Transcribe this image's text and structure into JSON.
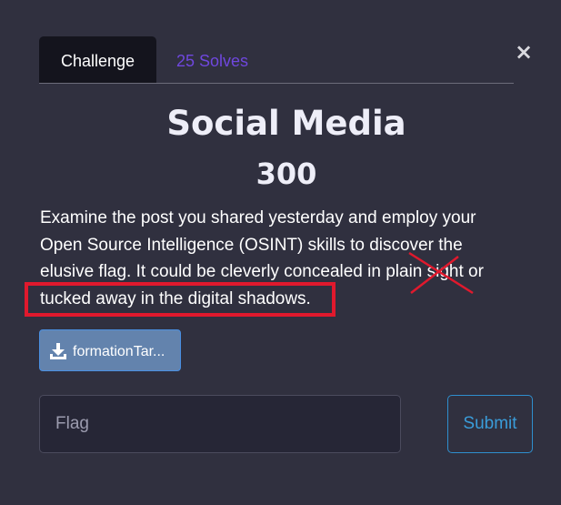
{
  "modal": {
    "close_label": "×"
  },
  "tabs": [
    {
      "label": "Challenge",
      "active": true
    },
    {
      "label": "25 Solves",
      "active": false
    }
  ],
  "challenge": {
    "name": "Social Media",
    "points": "300",
    "description_lines": [
      "Examine the post you shared yesterday and employ your",
      "Open Source Intelligence (OSINT) skills to discover the",
      "elusive flag. It could be cleverly concealed in plain sight or",
      "tucked away in the digital shadows."
    ]
  },
  "file": {
    "label": "formationTar...",
    "icon": "download-icon"
  },
  "flag_form": {
    "placeholder": "Flag",
    "value": "",
    "submit_label": "Submit"
  },
  "colors": {
    "background": "#30303f",
    "active_tab": "#14141d",
    "solves_link": "#6f47de",
    "download_button": "#6383ad",
    "submit_border": "#2f8fce",
    "annotation_red": "#e0192d"
  }
}
